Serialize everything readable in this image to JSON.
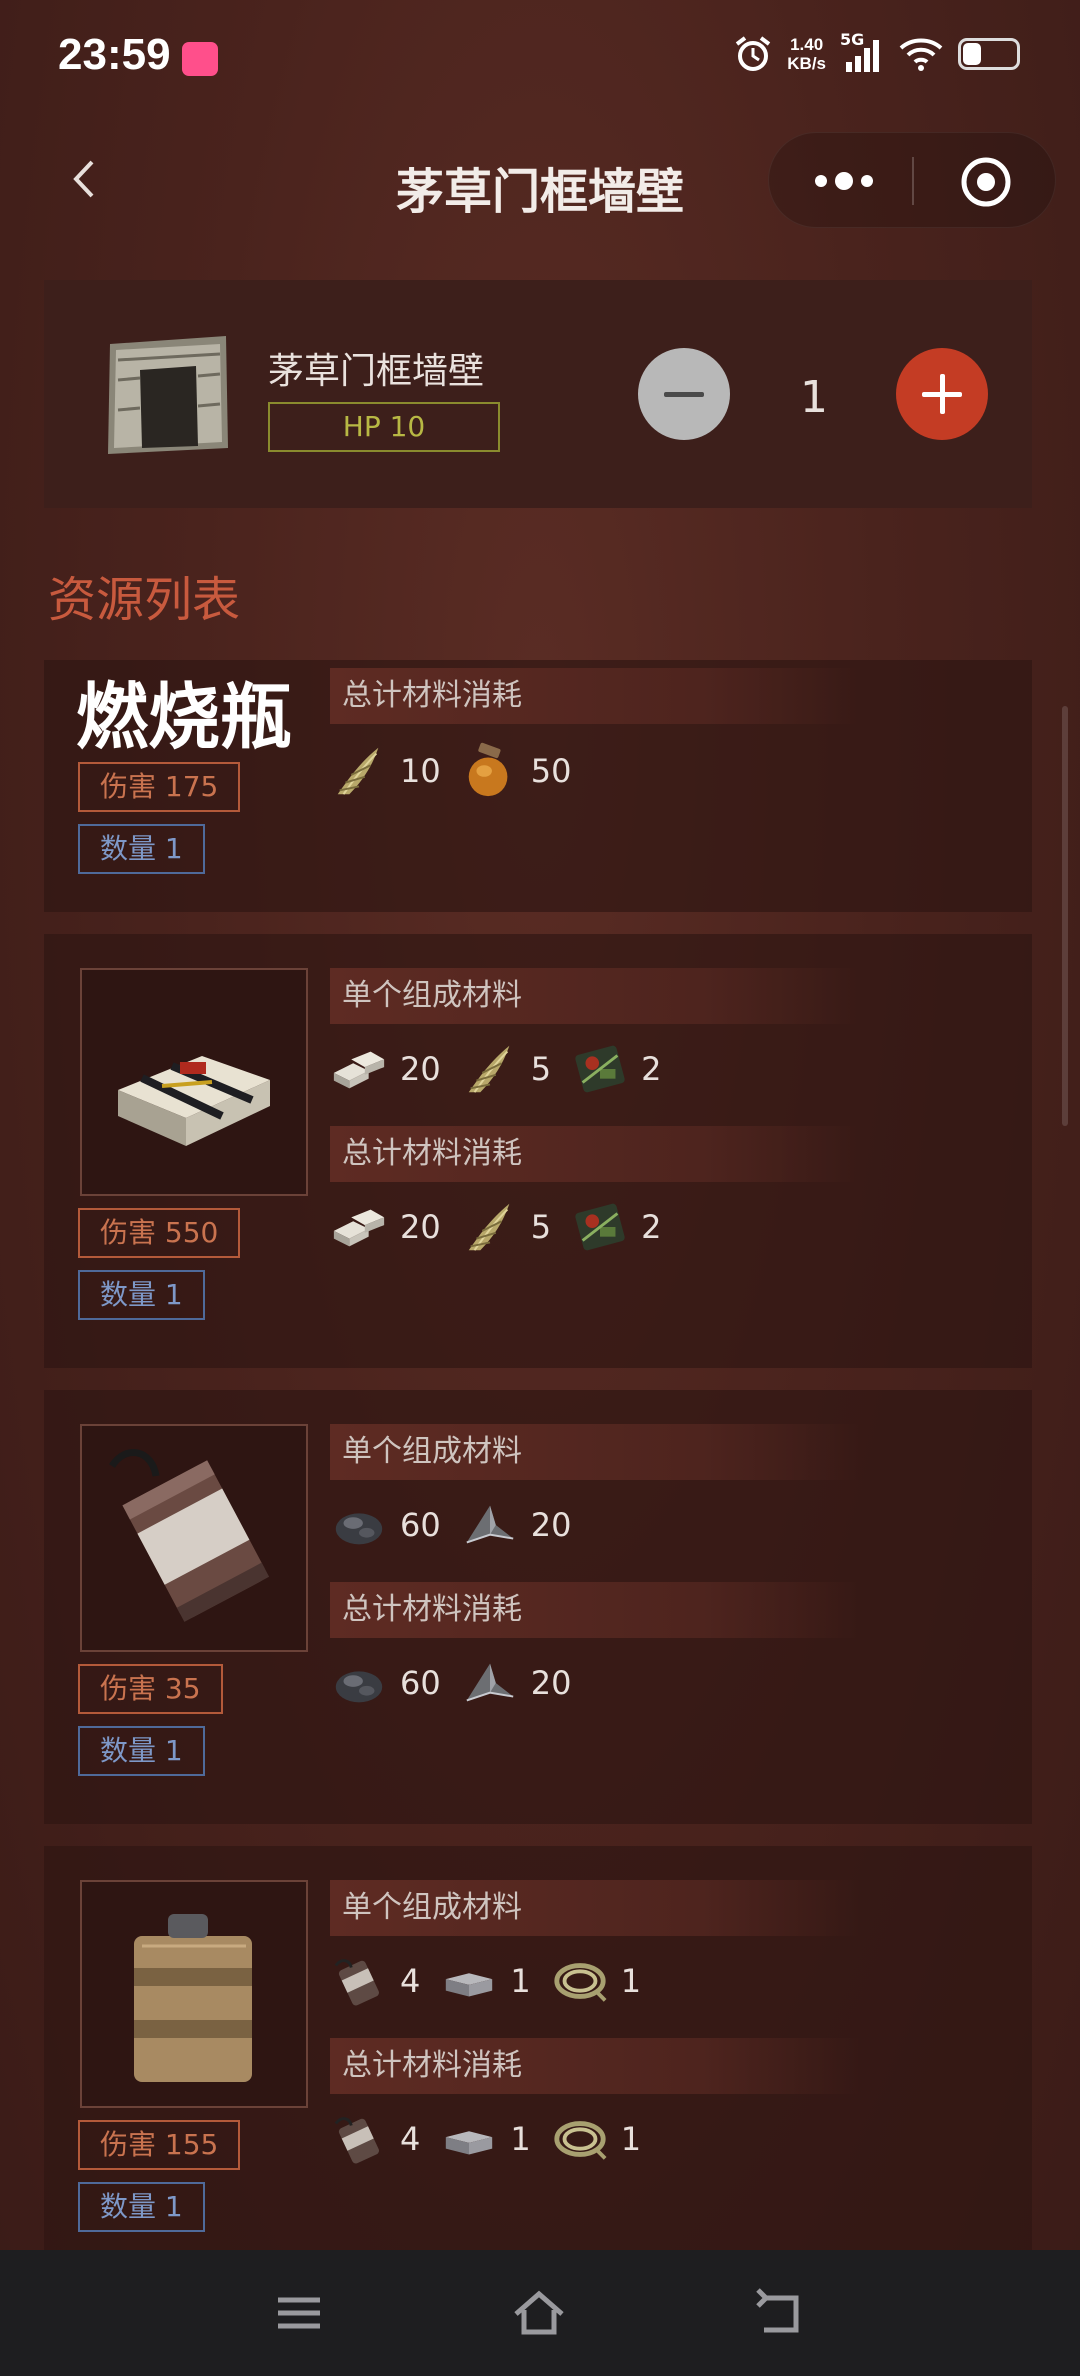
{
  "status": {
    "time": "23:59",
    "net_speed_top": "1.40",
    "net_speed_bottom": "KB/s",
    "network": "5G"
  },
  "nav": {
    "back_icon": "chevron-left-icon",
    "title": "茅草门框墙壁",
    "more_icon": "more-dots-icon",
    "target_icon": "target-icon"
  },
  "header": {
    "name": "茅草门框墙壁",
    "hp": "HP 10",
    "quantity": "1",
    "minus_icon": "minus-icon",
    "plus_icon": "plus-icon"
  },
  "section_title": "资源列表",
  "items": [
    {
      "name": "燃烧瓶",
      "damage": "伤害 175",
      "count": "数量 1",
      "total_label": "总计材料消耗",
      "total": [
        {
          "icon": "cloth-icon",
          "value": "10"
        },
        {
          "icon": "low-grade-fuel-icon",
          "value": "50"
        }
      ]
    },
    {
      "name": "",
      "damage": "伤害 550",
      "count": "数量 1",
      "single_label": "单个组成材料",
      "total_label": "总计材料消耗",
      "single": [
        {
          "icon": "explosives-icon",
          "value": "20"
        },
        {
          "icon": "cloth-icon",
          "value": "5"
        },
        {
          "icon": "tech-trash-icon",
          "value": "2"
        }
      ],
      "total": [
        {
          "icon": "explosives-icon",
          "value": "20"
        },
        {
          "icon": "cloth-icon",
          "value": "5"
        },
        {
          "icon": "tech-trash-icon",
          "value": "2"
        }
      ]
    },
    {
      "name": "",
      "damage": "伤害 35",
      "count": "数量 1",
      "single_label": "单个组成材料",
      "total_label": "总计材料消耗",
      "single": [
        {
          "icon": "gunpowder-icon",
          "value": "60"
        },
        {
          "icon": "metal-fragments-icon",
          "value": "20"
        }
      ],
      "total": [
        {
          "icon": "gunpowder-icon",
          "value": "60"
        },
        {
          "icon": "metal-fragments-icon",
          "value": "20"
        }
      ]
    },
    {
      "name": "",
      "damage": "伤害 155",
      "count": "数量 1",
      "single_label": "单个组成材料",
      "total_label": "总计材料消耗",
      "single": [
        {
          "icon": "beancan-grenade-icon",
          "value": "4"
        },
        {
          "icon": "metal-box-icon",
          "value": "1"
        },
        {
          "icon": "rope-icon",
          "value": "1"
        }
      ],
      "total": [
        {
          "icon": "beancan-grenade-icon",
          "value": "4"
        },
        {
          "icon": "metal-box-icon",
          "value": "1"
        },
        {
          "icon": "rope-icon",
          "value": "1"
        }
      ]
    }
  ],
  "bottom_nav": {
    "menu_icon": "menu-icon",
    "home_icon": "home-icon",
    "back_icon": "back-arrow-icon"
  },
  "colors": {
    "accent": "#c43c24",
    "section_title": "#c85a3e",
    "hp_border": "#8a8b2e",
    "damage_border": "#b45a3a",
    "count_border": "#4f6a9a"
  }
}
